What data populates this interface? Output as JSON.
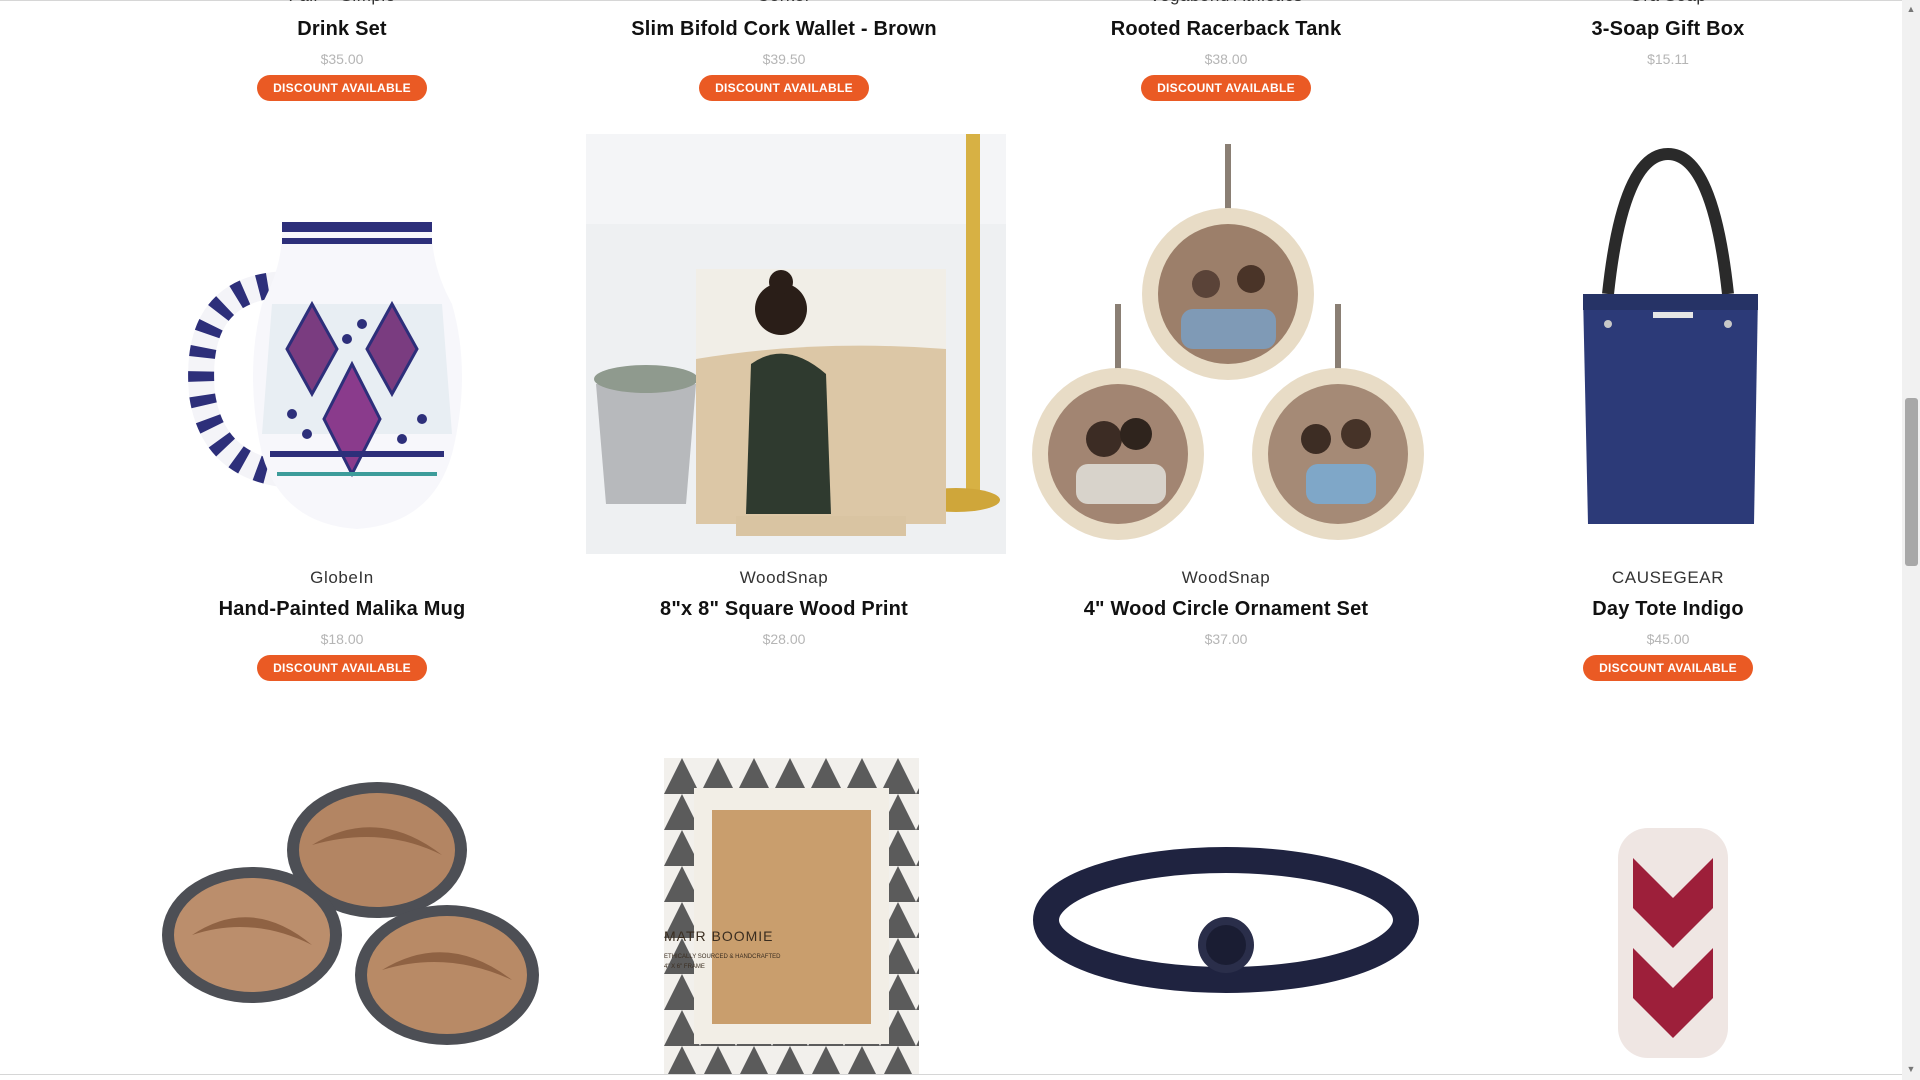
{
  "badge_label": "DISCOUNT AVAILABLE",
  "row1": [
    {
      "brand": "Fair + Simple",
      "title": "Drink Set",
      "price": "$35.00",
      "discount": true
    },
    {
      "brand": "Corkor",
      "title": "Slim Bifold Cork Wallet - Brown",
      "price": "$39.50",
      "discount": true
    },
    {
      "brand": "Vegabond Athletics",
      "title": "Rooted Racerback Tank",
      "price": "$38.00",
      "discount": true
    },
    {
      "brand": "Ora Soap",
      "title": "3-Soap Gift Box",
      "price": "$15.11",
      "discount": false
    }
  ],
  "row2": [
    {
      "brand": "GlobeIn",
      "title": "Hand-Painted Malika Mug",
      "price": "$18.00",
      "discount": true,
      "image": "painted-mug-image"
    },
    {
      "brand": "WoodSnap",
      "title": "8\"x 8\" Square Wood Print",
      "price": "$28.00",
      "discount": false,
      "image": "wood-print-image"
    },
    {
      "brand": "WoodSnap",
      "title": "4\" Wood Circle Ornament Set",
      "price": "$37.00",
      "discount": false,
      "image": "ornament-set-image"
    },
    {
      "brand": "CAUSEGEAR",
      "title": "Day Tote Indigo",
      "price": "$45.00",
      "discount": true,
      "image": "tote-bag-image"
    }
  ],
  "row3": [
    {
      "image": "wooden-bowls-image"
    },
    {
      "image": "photo-frame-image",
      "frame_logo": "MATR BOOMIE",
      "frame_tagline_1": "ETHICALLY SOURCED & HANDCRAFTED",
      "frame_tagline_2": "4\" X 6\" FRAME"
    },
    {
      "image": "belt-image"
    },
    {
      "image": "woven-vase-image"
    }
  ],
  "colors": {
    "badge": "#ea5a24",
    "price": "#b5b5b5",
    "title": "#111111"
  }
}
